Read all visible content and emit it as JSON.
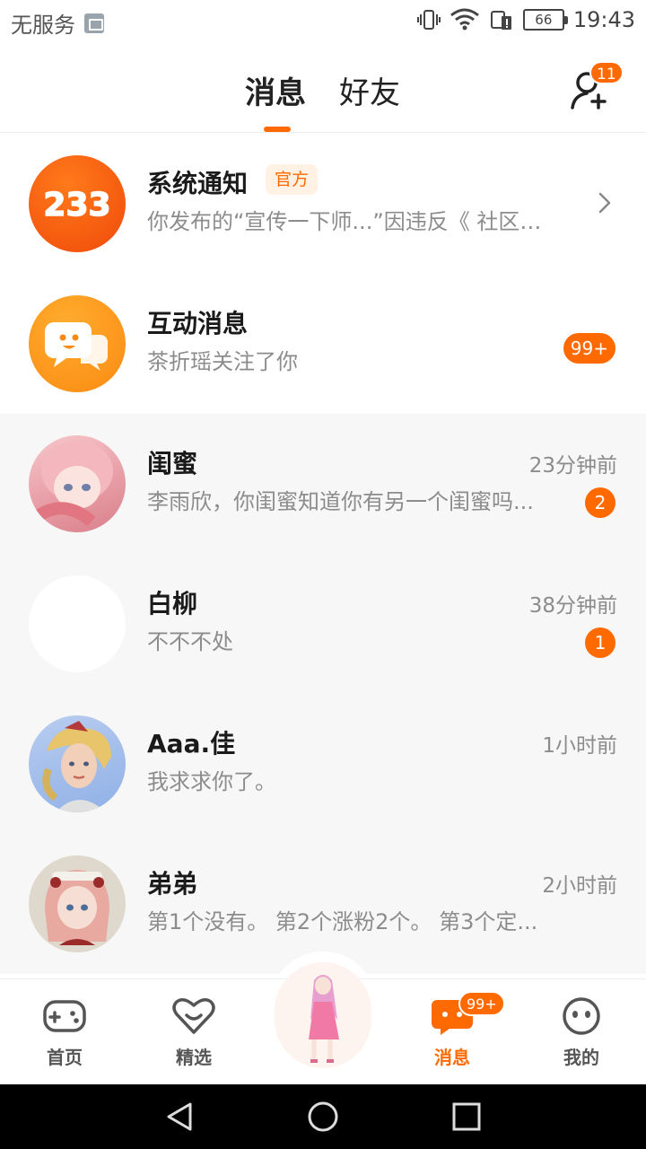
{
  "status_bar": {
    "carrier": "无服务",
    "battery": "66",
    "time": "19:43",
    "icons": [
      "image-icon",
      "vibrate-icon",
      "wifi-icon",
      "battery-saver-icon",
      "battery-icon"
    ]
  },
  "header": {
    "tabs": [
      {
        "label": "消息",
        "active": true
      },
      {
        "label": "好友",
        "active": false
      }
    ],
    "add_friend_badge": "11"
  },
  "conversations": [
    {
      "name": "系统通知",
      "tag": "官方",
      "preview": "你发布的“宣传一下师...”因违反《 社区行为...",
      "avatar_text": "233",
      "icon": "chevron-right-icon"
    },
    {
      "name": "互动消息",
      "preview": "茶折瑶关注了你",
      "badge": "99+",
      "icon": "chat-smile-icon"
    },
    {
      "name": "闺蜜",
      "preview": "李雨欣，你闺蜜知道你有另一个闺蜜吗...",
      "time": "23分钟前",
      "badge": "2"
    },
    {
      "name": "白柳",
      "preview": "不不不处",
      "time": "38分钟前",
      "badge": "1"
    },
    {
      "name": "Aaa.佳",
      "preview": "我求求你了。",
      "time": "1小时前"
    },
    {
      "name": "弟弟",
      "preview": "第1个没有。 第2个涨粉2个。 第3个定...",
      "time": "2小时前"
    }
  ],
  "bottom_nav": {
    "items": [
      {
        "label": "首页",
        "icon": "gamepad-icon",
        "active": false
      },
      {
        "label": "精选",
        "icon": "heart-icon",
        "active": false
      },
      {
        "label": "消息",
        "icon": "message-icon",
        "active": true
      },
      {
        "label": "我的",
        "icon": "face-icon",
        "active": false
      }
    ],
    "message_badge": "99+"
  },
  "colors": {
    "accent": "#ff6a00",
    "text_primary": "#1a1a1a",
    "text_secondary": "#8c8c8c",
    "list_bg": "#f7f7f7"
  }
}
